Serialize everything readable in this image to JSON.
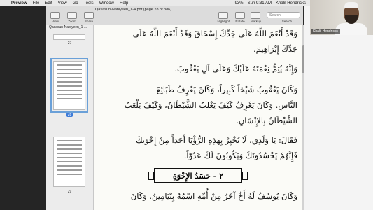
{
  "menubar": {
    "apple_icon": "",
    "items": [
      "Preview",
      "File",
      "Edit",
      "View",
      "Go",
      "Tools",
      "Window",
      "Help"
    ],
    "battery": "93%",
    "time": "Sun 9:31 AM",
    "user": "Khalil Hendricks"
  },
  "toolbar": {
    "doc_title": "Qasasun-Nabiyeen_1-4.pdf (page 28 of 386)",
    "view_label": "View",
    "zoom_label": "Zoom",
    "share_label": "Share",
    "highlight_label": "Highlight",
    "rotate_label": "Rotate",
    "markup_label": "Markup",
    "search_label": "Search",
    "search_placeholder": "Search"
  },
  "sidebar": {
    "header": "Qasasun-Nabiyeen_1-...",
    "pages": [
      "27",
      "28",
      "29"
    ]
  },
  "video": {
    "name_tag": "Khalil Hendricks"
  },
  "document": {
    "lines": [
      "وَقَدْ أَنْعَمَ اللَّهُ عَلَى جَدِّكَ إِسْحَاقَ وَقَدْ أَنْعَمَ اللَّهُ عَلَى",
      "جَدِّكَ إِبْرَاهِيمَ.",
      "وَإِنَّهُ يُتِمُّ نِعْمَتَهُ عَلَيْكَ وَعَلَى آلِ يَعْقُوبَ.",
      "وَكَانَ يَعْقُوبُ شَيْخاً كَبِيراً، وَكَانَ يَعْرِفُ طَبَائِعَ",
      "النَّاسِ. وَكَانَ يَعْرِفُ كَيْفَ يَغْلِبُ الشَّيْطَانُ، وَكَيْفَ يَلْعَبُ",
      "الشَّيْطَانُ بِالإِنْسَانِ.",
      "فَقَالَ: يَا وَلَدِي، لَا تُخْبِرْ بِهَذِهِ الرُّؤْيَا أَحَداً مِنْ إِخْوَتِكَ",
      "فَإِنَّهُمْ يَحْسُدُونَكَ وَيَكُونُونَ لَكَ عَدُوّاً.",
      "وَكَانَ يُوسُفُ لَهُ أَخٌ آخَرُ مِنْ أُمِّهِ اسْمُهُ بِنْيَامِينُ. وَكَانَ"
    ],
    "heading": "٢ - حَسَدُ الإِخْوَةِ"
  }
}
